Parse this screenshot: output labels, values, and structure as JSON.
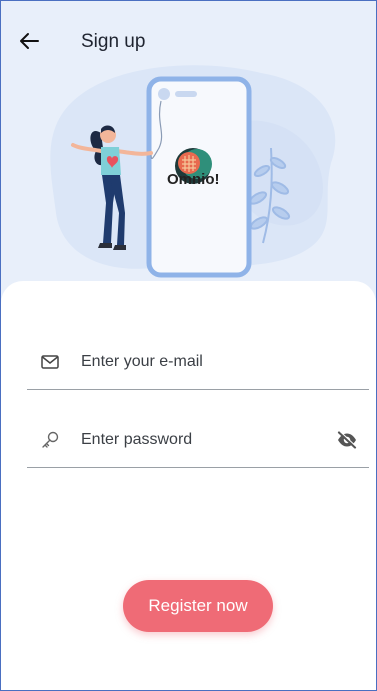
{
  "header": {
    "title": "Sign up",
    "back_icon": "arrow-left-icon"
  },
  "illustration": {
    "brand_name": "Omnio!",
    "logo_icon": "omnio-logo-icon"
  },
  "form": {
    "email": {
      "placeholder": "Enter your e-mail",
      "value": "",
      "icon": "mail-icon"
    },
    "password": {
      "placeholder": "Enter password",
      "value": "",
      "icon": "key-icon",
      "toggle_icon": "eye-off-icon"
    },
    "register_label": "Register now"
  },
  "colors": {
    "background": "#e8effa",
    "accent": "#ef6b76",
    "illustration_blue": "#8fb3e8",
    "frame_border": "#4a6fc1"
  }
}
